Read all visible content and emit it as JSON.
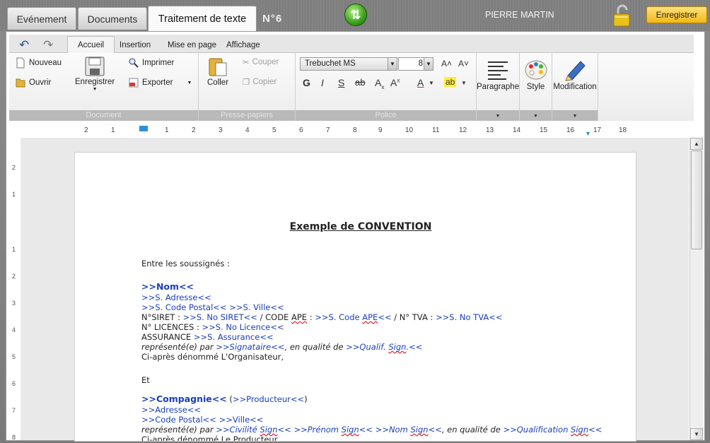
{
  "topbar": {
    "tabs": [
      "Evénement",
      "Documents",
      "Traitement de texte"
    ],
    "doc_number": "N°6",
    "user": "PIERRE MARTIN",
    "save_label": "Enregistrer"
  },
  "ribbon_tabs": [
    "Accueil",
    "Insertion",
    "Mise en page",
    "Affichage"
  ],
  "ribbon": {
    "document": {
      "nouveau": "Nouveau",
      "ouvrir": "Ouvrir",
      "enregistrer": "Enregistrer",
      "imprimer": "Imprimer",
      "exporter": "Exporter",
      "label": "Document"
    },
    "clipboard": {
      "coller": "Coller",
      "couper": "Couper",
      "copier": "Copier",
      "label": "Presse-papiers"
    },
    "font": {
      "family": "Trebuchet MS",
      "size": "8",
      "label": "Police",
      "bold": "G",
      "italic": "I",
      "underline": "S",
      "strike": "ab",
      "color": "A",
      "highlight": "ab"
    },
    "paragraphe": "Paragraphe",
    "style": "Style",
    "modification": "Modification"
  },
  "ruler": {
    "h_ticks": [
      "2",
      "1",
      "1",
      "2",
      "3",
      "4",
      "5",
      "6",
      "7",
      "8",
      "9",
      "10",
      "11",
      "12",
      "13",
      "14",
      "15",
      "16",
      "17",
      "18"
    ],
    "v_ticks": [
      "2",
      "1",
      "1",
      "2",
      "3",
      "4",
      "5",
      "6",
      "7",
      "8"
    ]
  },
  "document": {
    "title": "Exemple de CONVENTION",
    "intro": "Entre les soussignés :",
    "nom": ">>Nom<<",
    "adresse": ">>S. Adresse<<",
    "cp_ville_a": ">>S. Code Postal<<",
    "cp_ville_b": ">>S. Ville<<",
    "siret_label": "N°SIRET : ",
    "siret_val": ">>S. No SIRET<<",
    "ape_label": " / CODE ",
    "ape_word": "APE",
    "ape_colon": " : ",
    "ape_val_a": ">>S. Code ",
    "ape_val_b": "APE",
    "ape_val_c": "<<",
    "tva_label": " / N° TVA : ",
    "tva_val": ">>S. No TVA<<",
    "licences_label": "N° LICENCES : ",
    "licences_val": ">>S. No Licence<<",
    "assurance_label": "ASSURANCE ",
    "assurance_val": ">>S. Assurance<<",
    "represente_a": "représenté(e) par ",
    "signataire": ">>Signataire<<",
    "qualite": ", en qualité de  ",
    "qualif_a": ">>Qualif. ",
    "qualif_b": "Sign",
    "qualif_c": ".<<",
    "organisateur": "Ci-après dénommé L'Organisateur,",
    "et": "Et",
    "compagnie": ">>Compagnie<<",
    "producteur_open": " (",
    "producteur": ">>Producteur<<",
    "producteur_close": ")",
    "adresse2": ">>Adresse<<",
    "cp2_a": ">>Code Postal<<",
    "cp2_b": ">>Ville<<",
    "rep2_a": "représenté(e) par ",
    "civ_a": ">>Civilité ",
    "civ_b": "Sign",
    "civ_c": "<<",
    "pre_a": ">>Prénom ",
    "pre_b": "Sign",
    "pre_c": "<<",
    "nom_a": ">>Nom ",
    "nom_b": "Sign",
    "nom_c": "<<",
    "qual2": ", en qualité de ",
    "qualif2_a": ">>Qualification ",
    "qualif2_b": "Sign",
    "qualif2_c": "<<",
    "last": "Ci-après dénommé Le Producteur"
  }
}
